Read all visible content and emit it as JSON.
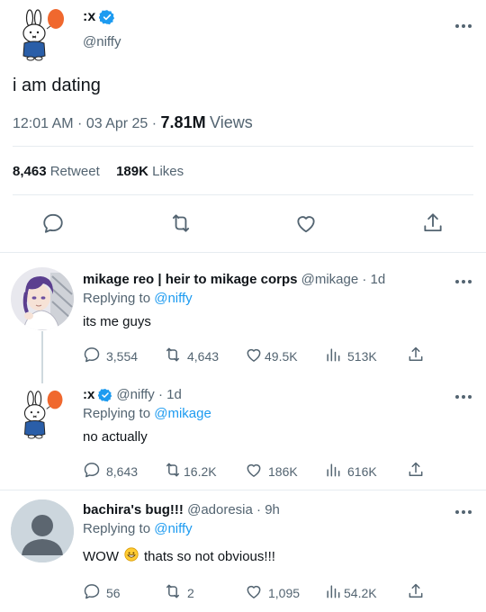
{
  "main_tweet": {
    "display_name": ":x",
    "handle": "@niffy",
    "text": "i am dating",
    "timestamp": "12:01 AM · 03 Apr 25 · ",
    "views_count": "7.81M",
    "views_label": "Views",
    "retweets_count": "8,463",
    "retweets_label": "Retweet",
    "likes_count": "189K",
    "likes_label": "Likes"
  },
  "replies": [
    {
      "display_name": "mikage reo | heir to mikage corps",
      "handle": "@mikage · 1d",
      "replying_prefix": "Replying to",
      "replying_to": "@niffy",
      "text": "its me guys",
      "comments": "3,554",
      "retweets": "4,643",
      "likes": "49.5K",
      "views": "513K"
    },
    {
      "display_name": ":x",
      "handle": "@niffy · 1d",
      "replying_prefix": "Replying to",
      "replying_to": "@mikage",
      "text": "no actually",
      "comments": "8,643",
      "retweets": "16.2K",
      "likes": "186K",
      "views": "616K"
    },
    {
      "display_name": "bachira's bug!!!",
      "handle": "@adoresia · 9h",
      "replying_prefix": "Replying to",
      "replying_to": "@niffy",
      "text_before_emoji": "WOW",
      "text_after_emoji": "thats so not obvious!!!",
      "comments": "56",
      "retweets": "2",
      "likes": "1,095",
      "views": "54.2K"
    }
  ],
  "colors": {
    "accent": "#1d9bf0",
    "text": "#0f1419",
    "muted": "#536471",
    "divider": "#e6ecf0",
    "balloon": "#f0682e"
  },
  "icons": [
    "verified-badge-icon",
    "more-options-icon",
    "reply-icon",
    "retweet-icon",
    "like-icon",
    "share-icon",
    "views-icon",
    "grinning-emoji-icon"
  ]
}
